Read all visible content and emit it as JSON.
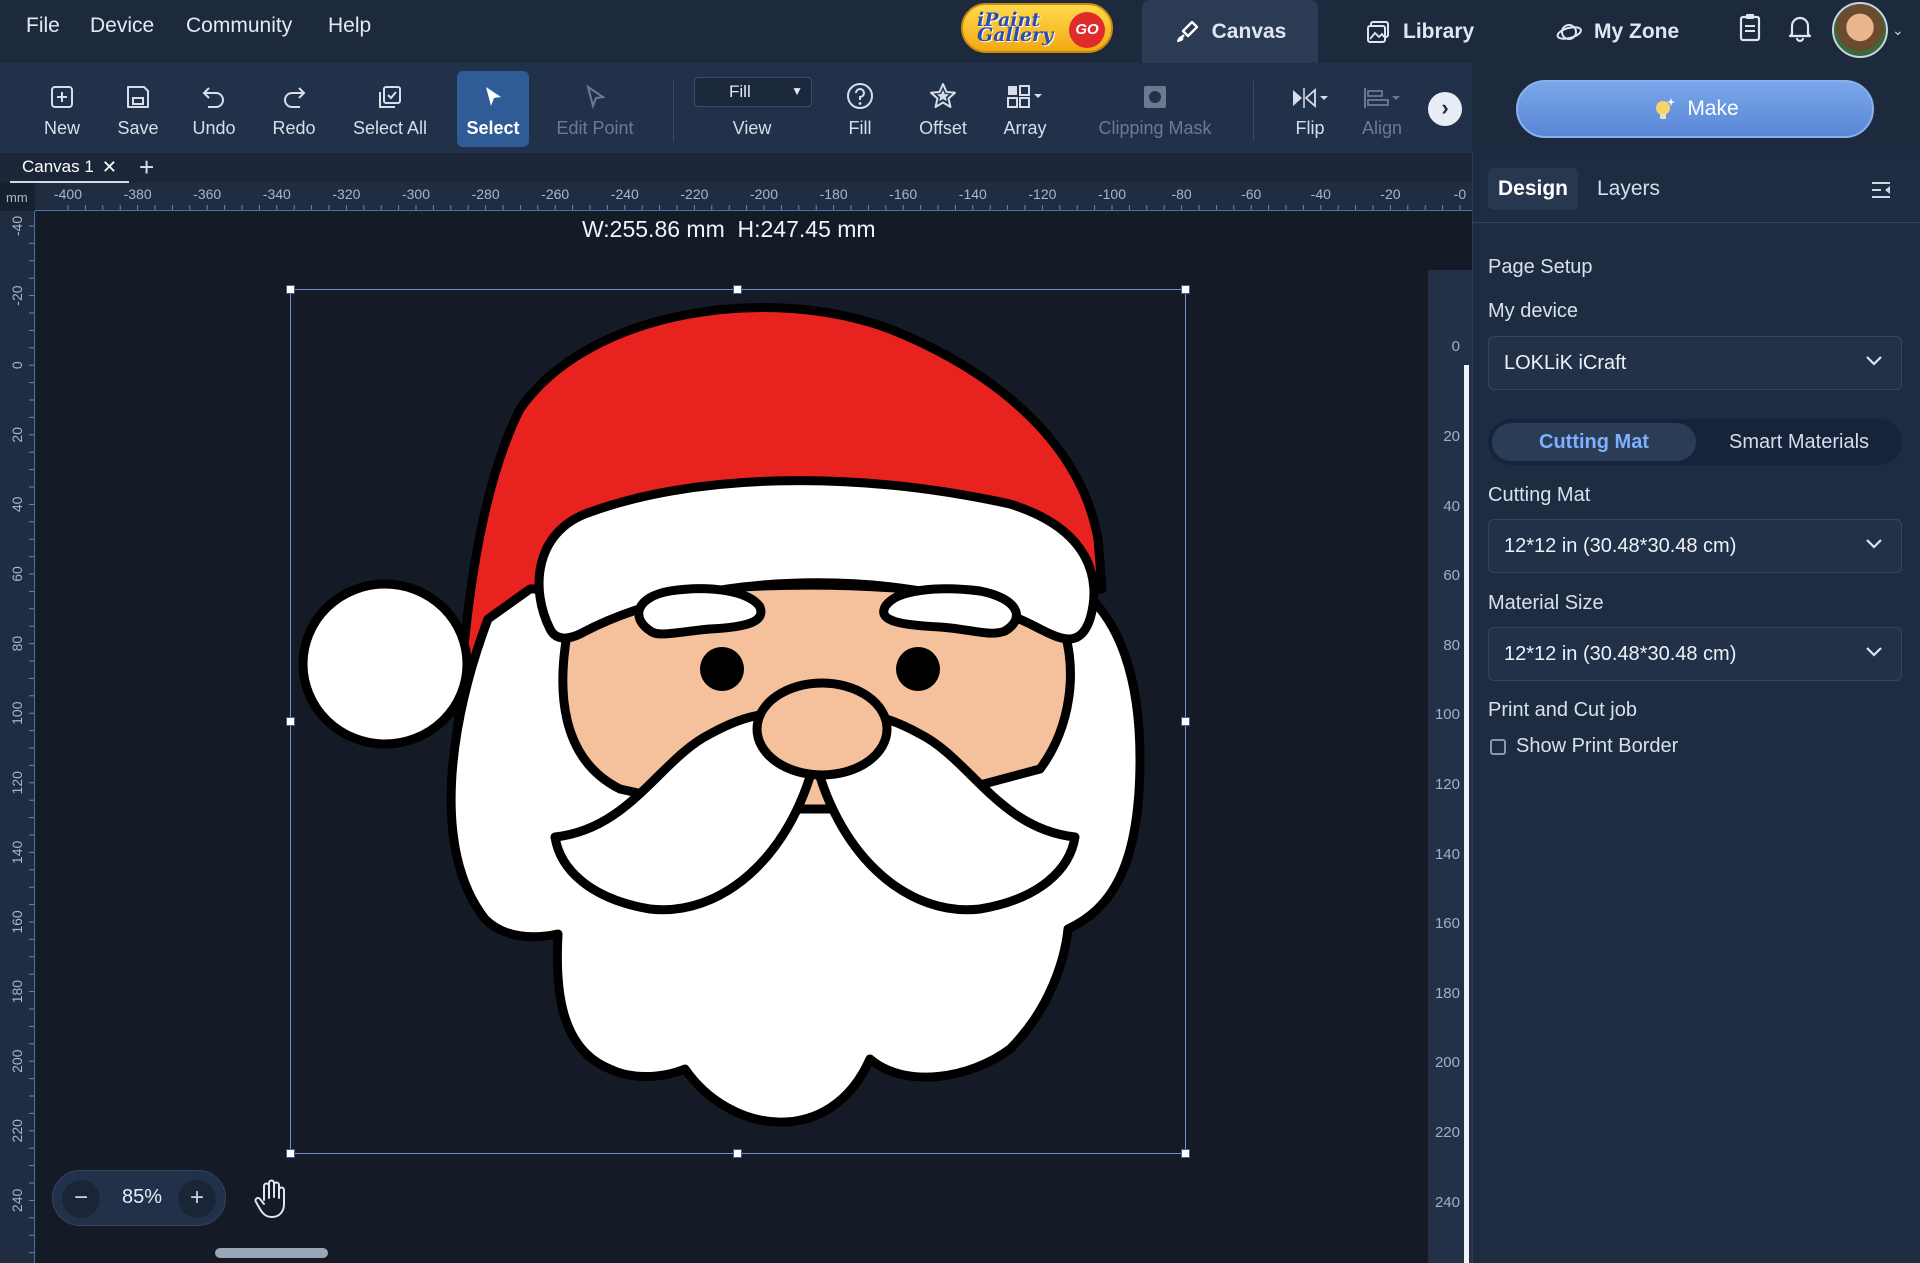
{
  "menu": [
    "File",
    "Device",
    "Community",
    "Help"
  ],
  "gallery": {
    "label": "iPaint Gallery",
    "go": "GO"
  },
  "tabs": {
    "canvas": "Canvas",
    "library": "Library",
    "myzone": "My Zone"
  },
  "toolbar": {
    "new": "New",
    "save": "Save",
    "undo": "Undo",
    "redo": "Redo",
    "select_all": "Select All",
    "select": "Select",
    "edit_point": "Edit Point",
    "view_value": "Fill",
    "view": "View",
    "fill": "Fill",
    "offset": "Offset",
    "array": "Array",
    "clipping_mask": "Clipping Mask",
    "flip": "Flip",
    "align": "Align"
  },
  "make_button": "Make",
  "canvas_tab": "Canvas 1",
  "ruler": {
    "unit": "mm",
    "h_labels": [
      "-400",
      "-380",
      "-360",
      "-340",
      "-320",
      "-300",
      "-280",
      "-260",
      "-240",
      "-220",
      "-200",
      "-180",
      "-160",
      "-140",
      "-120",
      "-100",
      "-80",
      "-60",
      "-40",
      "-20",
      "-0"
    ],
    "v_labels": [
      "-40",
      "-20",
      "0",
      "20",
      "40",
      "60",
      "80",
      "100",
      "120",
      "140",
      "160",
      "180",
      "200",
      "220",
      "240"
    ],
    "mat_labels": [
      "0",
      "20",
      "40",
      "60",
      "80",
      "100",
      "120",
      "140",
      "160",
      "180",
      "200",
      "220",
      "240"
    ]
  },
  "selection": {
    "dimensions": "W:255.86 mm  H:247.45 mm"
  },
  "zoom": {
    "value": "85%",
    "minus": "−",
    "plus": "+"
  },
  "panel": {
    "tab_design": "Design",
    "tab_layers": "Layers",
    "page_setup": "Page Setup",
    "my_device_label": "My device",
    "my_device_value": "LOKLiK iCraft",
    "seg_cutting_mat": "Cutting Mat",
    "seg_smart_materials": "Smart Materials",
    "cutting_mat_label": "Cutting Mat",
    "cutting_mat_value": "12*12 in (30.48*30.48 cm)",
    "material_size_label": "Material Size",
    "material_size_value": "12*12 in (30.48*30.48 cm)",
    "print_cut_label": "Print and Cut job",
    "show_print_border": "Show Print Border",
    "show_print_border_checked": false
  },
  "colors": {
    "accent": "#2f5c96",
    "make": "#6a96e0",
    "santa_red": "#e8221e",
    "skin": "#f4c19c"
  }
}
